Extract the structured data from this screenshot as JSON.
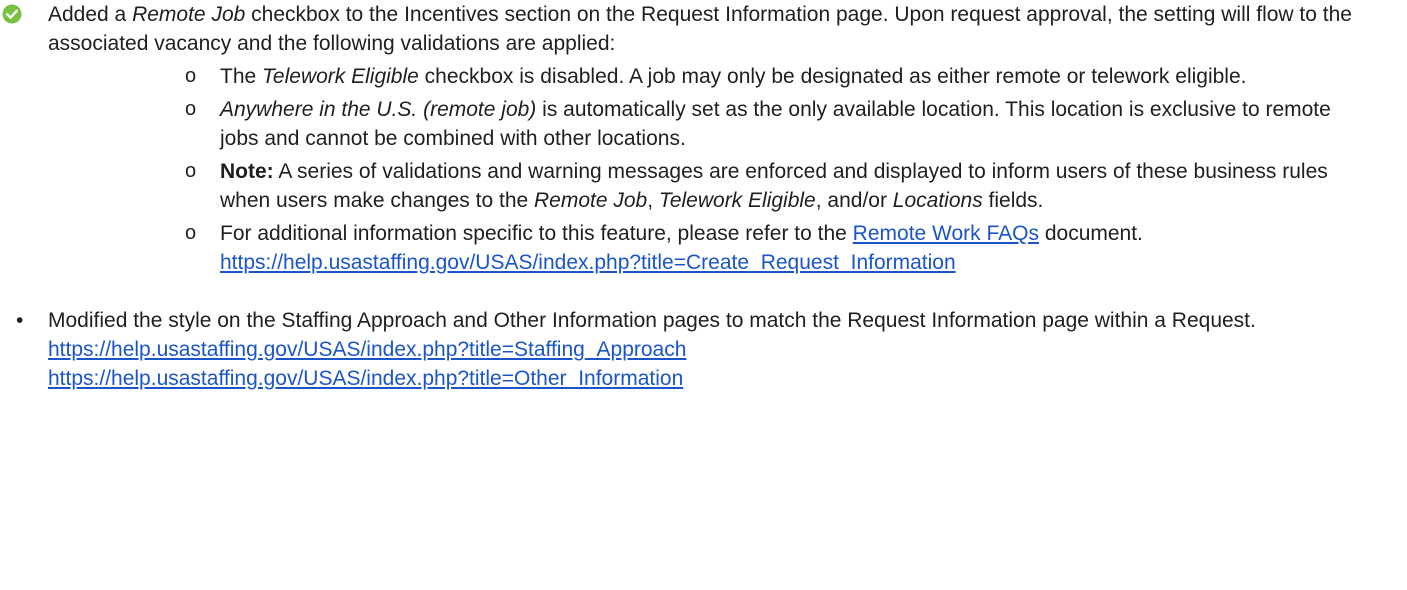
{
  "colors": {
    "check_bullet": "#7ac143",
    "link": "#1a55c9",
    "text": "#1f1f1f"
  },
  "item1": {
    "icon": "check-circle-icon",
    "text_a": "Added a ",
    "em_remote_job": "Remote Job",
    "text_b": " checkbox to the Incentives section on the Request Information page. Upon request approval, the setting will flow to the associated vacancy and the following validations are applied:",
    "subitems": {
      "s1": {
        "bullet": "o",
        "text_a": "The ",
        "em": "Telework Eligible",
        "text_b": " checkbox is disabled. A job may only be designated as either remote or telework eligible."
      },
      "s2": {
        "bullet": "o",
        "em": "Anywhere in the U.S. (remote job)",
        "text_b": " is automatically set as the only available location. This location is exclusive to remote jobs and cannot be combined with other locations."
      },
      "s3": {
        "bullet": "o",
        "strong": "Note:",
        "text_a": " A series of validations and warning messages are enforced and displayed to inform users of these business rules when users make changes to the ",
        "em_1": "Remote Job",
        "text_b": ", ",
        "em_2": "Telework Eligible",
        "text_c": ", and/or ",
        "em_3": "Locations",
        "text_d": " fields."
      },
      "s4": {
        "bullet": "o",
        "text_a": "For additional information specific to this feature, please refer to the ",
        "link_text": "Remote Work FAQs",
        "text_b": " document.",
        "url": "https://help.usastaffing.gov/USAS/index.php?title=Create_Request_Information"
      }
    }
  },
  "item2": {
    "bullet": "•",
    "text": "Modified the style on the Staffing Approach and Other Information pages to match the Request Information page within a Request.",
    "url_1": "https://help.usastaffing.gov/USAS/index.php?title=Staffing_Approach",
    "url_2": "https://help.usastaffing.gov/USAS/index.php?title=Other_Information"
  }
}
